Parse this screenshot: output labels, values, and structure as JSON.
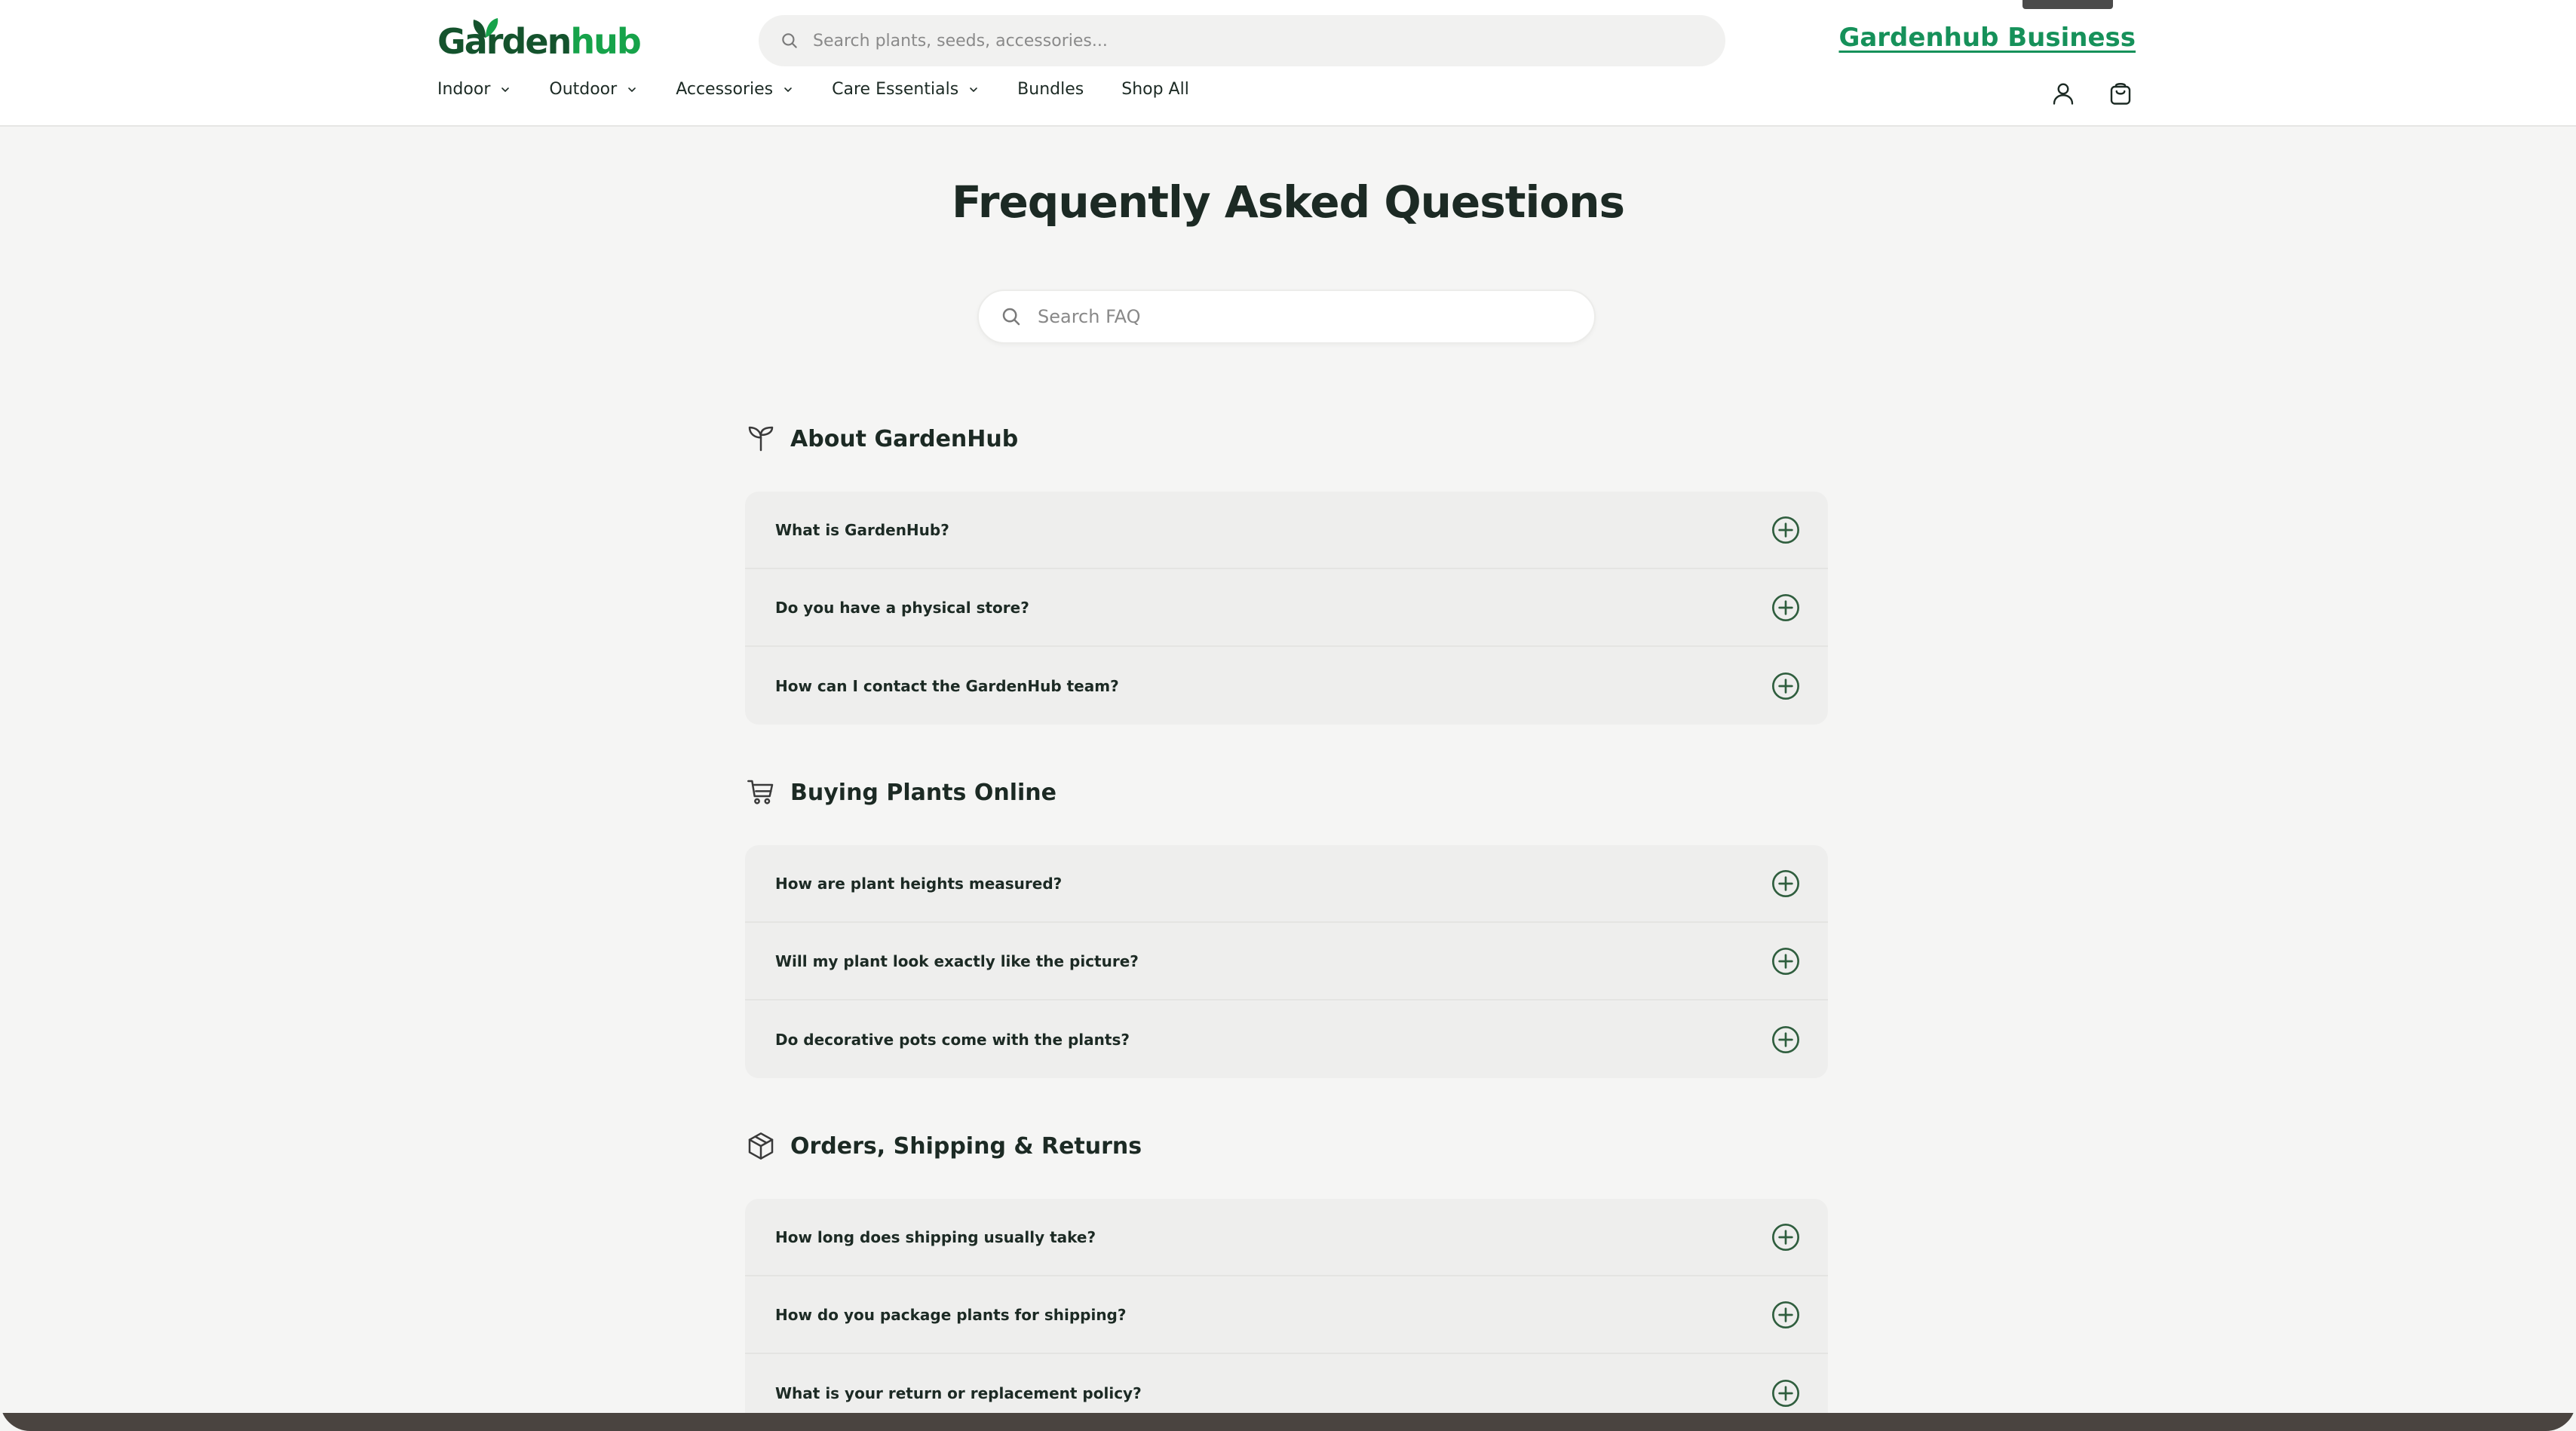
{
  "header": {
    "logo_part1": "Garden",
    "logo_part2": "hub",
    "search_placeholder": "Search plants, seeds, accessories...",
    "business_link": "Gardenhub Business",
    "nav": [
      {
        "label": "Indoor",
        "has_dropdown": true
      },
      {
        "label": "Outdoor",
        "has_dropdown": true
      },
      {
        "label": "Accessories",
        "has_dropdown": true
      },
      {
        "label": "Care Essentials",
        "has_dropdown": true
      },
      {
        "label": "Bundles",
        "has_dropdown": false
      },
      {
        "label": "Shop All",
        "has_dropdown": false
      }
    ],
    "icons": [
      "user-icon",
      "cart-icon"
    ]
  },
  "main": {
    "title": "Frequently Asked Questions",
    "search_placeholder": "Search FAQ",
    "sections": [
      {
        "icon": "sprout-icon",
        "title": "About GardenHub",
        "questions": [
          "What is GardenHub?",
          "Do you have a physical store?",
          "How can I contact the GardenHub team?"
        ]
      },
      {
        "icon": "cart-icon",
        "title": "Buying Plants Online",
        "questions": [
          "How are plant heights measured?",
          "Will my plant look exactly like the picture?",
          "Do decorative pots come with the plants?"
        ]
      },
      {
        "icon": "box-icon",
        "title": "Orders, Shipping & Returns",
        "questions": [
          "How long does shipping usually take?",
          "How do you package plants for shipping?",
          "What is your return or replacement policy?"
        ]
      }
    ]
  },
  "colors": {
    "brand_dark": "#14532d",
    "brand_green": "#16a34a",
    "business_link": "#16915a",
    "text": "#1c2a24",
    "page_bg": "#f5f5f4",
    "card_bg": "#eeeeed",
    "plus_icon": "#2f5e3e"
  }
}
